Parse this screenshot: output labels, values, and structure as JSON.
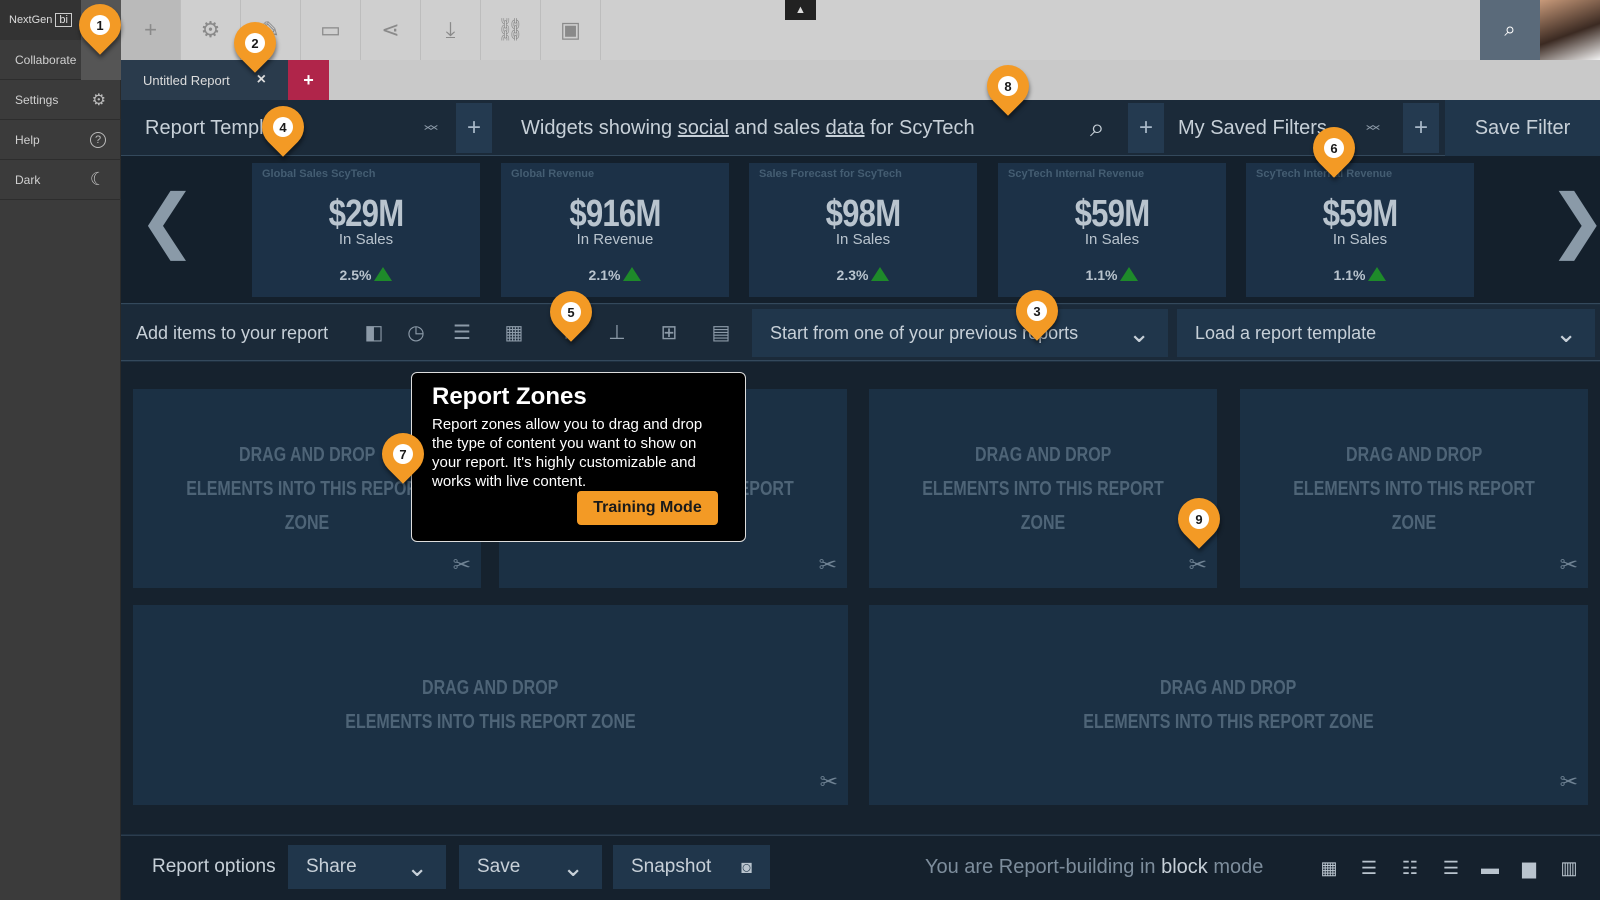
{
  "sidebar": {
    "logo_text": "NextGen",
    "logo_badge": "bi",
    "items": [
      {
        "label": "Collaborate"
      },
      {
        "label": "Settings",
        "icon": "gears-icon"
      },
      {
        "label": "Help",
        "icon": "help-circle-icon"
      },
      {
        "label": "Dark",
        "icon": "moon-icon"
      }
    ]
  },
  "toolbar": {
    "plus_icon": "+",
    "gear_icon": "⚙",
    "edit_icon": "✎",
    "present_icon": "▭",
    "share_icon": "⋖",
    "download_icon": "⤓",
    "link_icon": "⛓",
    "devices_icon": "▣",
    "caret_up": "▲",
    "search_icon": "⌕"
  },
  "tabs": {
    "active_label": "Untitled Report",
    "close_icon": "×",
    "add_icon": "+"
  },
  "filters": {
    "templates_label": "Report Templates",
    "query_prefix": "Widgets showing ",
    "query_social": "social",
    "query_mid": " and sales ",
    "query_data": "data",
    "query_suffix": " for ScyTech",
    "saved_filters_label": "My Saved Filters",
    "save_filter_label": "Save Filter",
    "plus": "+",
    "up": "︿",
    "down": "﹀",
    "search_icon": "⌕"
  },
  "kpis": [
    {
      "title": "Global Sales ScyTech",
      "value": "$29M",
      "sub": "In Sales",
      "pct": "2.5%"
    },
    {
      "title": "Global Revenue",
      "value": "$916M",
      "sub": "In Revenue",
      "pct": "2.1%"
    },
    {
      "title": "Sales Forecast for ScyTech",
      "value": "$98M",
      "sub": "In Sales",
      "pct": "2.3%"
    },
    {
      "title": "ScyTech Internal Revenue",
      "value": "$59M",
      "sub": "In Sales",
      "pct": "1.1%"
    },
    {
      "title": "ScyTech Internal Revenue",
      "value": "$59M",
      "sub": "In Sales",
      "pct": "1.1%"
    }
  ],
  "kpi_trend_color": "#1e8a2a",
  "carousel": {
    "prev": "❮",
    "next": "❯"
  },
  "additems": {
    "label": "Add items to your report",
    "icons": {
      "panel": "◧",
      "clock": "◷",
      "database": "☰",
      "calendar": "▦",
      "pin": "⫯",
      "hierarchy": "⊥",
      "add_doc": "⊞",
      "table": "▤"
    },
    "previous_reports_label": "Start from one of your previous reports",
    "template_label": "Load a report template",
    "chevron": "⌄"
  },
  "zones": {
    "line1": "DRAG AND DROP",
    "line2": "ELEMENTS INTO THIS  REPORT ZONE",
    "tool_icon": "✂"
  },
  "popup": {
    "title": "Report Zones",
    "body": "Report zones allow you to drag and drop the type of content you want to show on your report.  It's highly customizable and works with live content.",
    "button": "Training Mode"
  },
  "bottom": {
    "report_options": "Report options",
    "share": "Share",
    "save": "Save",
    "snapshot": "Snapshot",
    "camera_icon": "📷",
    "mode_prefix": "You are Report-building in ",
    "mode_word": "block",
    "mode_suffix": " mode",
    "chevron": "⌄",
    "layout_icons": [
      "▦",
      "☰",
      "☷",
      "☰",
      "▬",
      "▆",
      "▥"
    ]
  },
  "markers": [
    "1",
    "2",
    "3",
    "4",
    "5",
    "6",
    "7",
    "8",
    "9"
  ],
  "colors": {
    "accent": "#f39a25",
    "tab_add": "#b0254a"
  }
}
